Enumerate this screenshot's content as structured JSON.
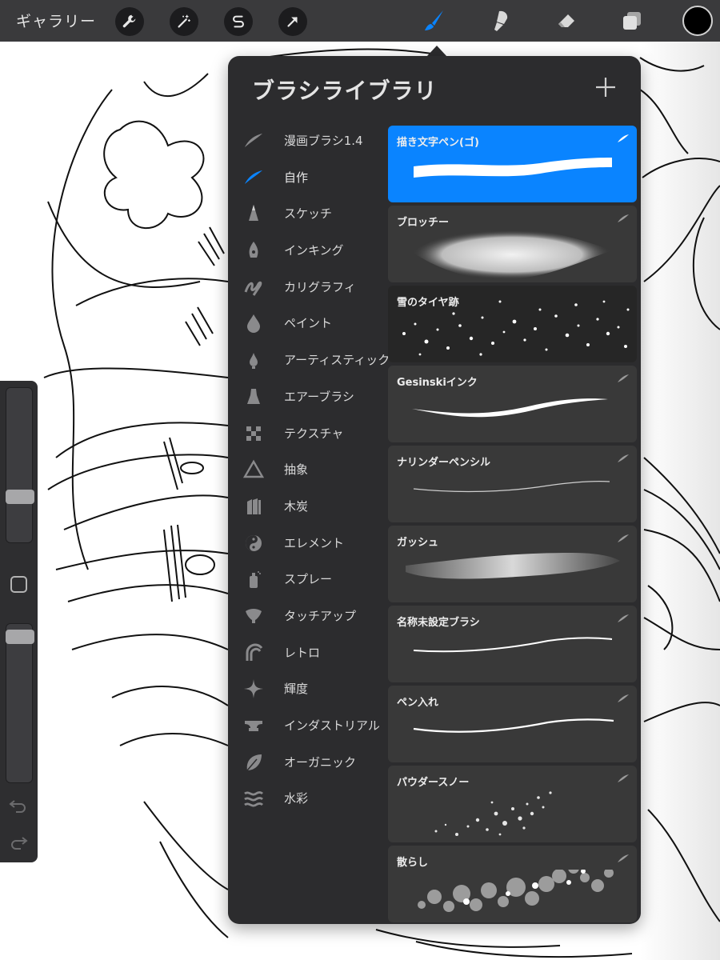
{
  "toolbar": {
    "gallery_label": "ギャラリー",
    "left_tools": [
      "wrench-icon",
      "magic-wand-icon",
      "selection-s-icon",
      "transform-arrow-icon"
    ],
    "right_tools": [
      "brush-icon",
      "smudge-icon",
      "eraser-icon",
      "layers-icon"
    ],
    "active_tool": "brush-icon",
    "active_color": "#0a84ff",
    "current_color": "#000000"
  },
  "library": {
    "title": "ブラシライブラリ",
    "add_icon": "plus-icon",
    "sets": [
      {
        "label": "漫画ブラシ1.4",
        "icon": "stroke-icon"
      },
      {
        "label": "自作",
        "icon": "stroke-icon"
      },
      {
        "label": "スケッチ",
        "icon": "pencil-tip-icon"
      },
      {
        "label": "インキング",
        "icon": "pen-nib-icon"
      },
      {
        "label": "カリグラフィ",
        "icon": "calligraphy-icon"
      },
      {
        "label": "ペイント",
        "icon": "drop-icon"
      },
      {
        "label": "アーティスティック",
        "icon": "drop-small-icon"
      },
      {
        "label": "エアーブラシ",
        "icon": "airbrush-icon"
      },
      {
        "label": "テクスチャ",
        "icon": "checker-icon"
      },
      {
        "label": "抽象",
        "icon": "triangle-icon"
      },
      {
        "label": "木炭",
        "icon": "charcoal-icon"
      },
      {
        "label": "エレメント",
        "icon": "yin-yang-icon"
      },
      {
        "label": "スプレー",
        "icon": "spray-can-icon"
      },
      {
        "label": "タッチアップ",
        "icon": "shell-icon"
      },
      {
        "label": "レトロ",
        "icon": "retro-arc-icon"
      },
      {
        "label": "輝度",
        "icon": "sparkle-icon"
      },
      {
        "label": "インダストリアル",
        "icon": "anvil-icon"
      },
      {
        "label": "オーガニック",
        "icon": "leaf-icon"
      },
      {
        "label": "水彩",
        "icon": "waves-icon"
      }
    ],
    "active_set": "自作",
    "brushes": [
      {
        "name": "描き文字ペン(ゴ)",
        "preview": "thick-stroke"
      },
      {
        "name": "ブロッチー",
        "preview": "blotch"
      },
      {
        "name": "雪のタイヤ跡",
        "preview": "snow-speckle"
      },
      {
        "name": "Gesinskiインク",
        "preview": "tapered-ink"
      },
      {
        "name": "ナリンダーペンシル",
        "preview": "thin-pencil"
      },
      {
        "name": "ガッシュ",
        "preview": "gouache"
      },
      {
        "name": "名称未設定ブラシ",
        "preview": "mono-line"
      },
      {
        "name": "ペン入れ",
        "preview": "pen-line"
      },
      {
        "name": "パウダースノー",
        "preview": "powder-dots"
      },
      {
        "name": "散らし",
        "preview": "bokeh-dots"
      }
    ],
    "selected_brush": "描き文字ペン(ゴ)"
  },
  "sidebar": {
    "brush_size_fraction": 0.28,
    "opacity_fraction": 0.96
  }
}
